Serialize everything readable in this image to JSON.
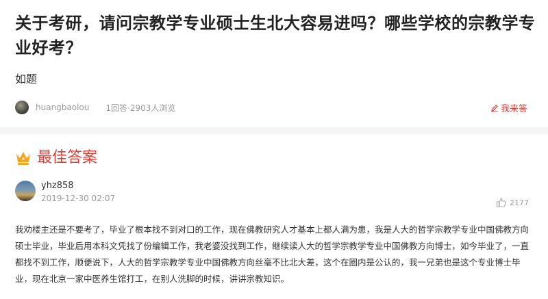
{
  "question": {
    "title": "关于考研，请问宗教学专业硕士生北大容易进吗？哪些学校的宗教学专业好考？",
    "description": "如题",
    "user": "huangbaolou",
    "stats": "1回答·2903人浏览",
    "answer_button": "我来答"
  },
  "best_answer": {
    "heading": "最佳答案",
    "author": "yhz858",
    "date": "2019-12-30 02:07",
    "likes": "2177",
    "text": "我劝楼主还是不要考了，毕业了根本找不到对口的工作，现在佛教研究人才基本上都人满为患，我是人大的哲学宗教学专业中国佛教方向硕士毕业，毕业后用本科文凭找了份编辑工作，我老婆没找到工作，继续读人大的哲学宗教学专业中国佛教方向博士，如今毕业了，一直都找不到工作，顺便说下，人大的哲学宗教学专业中国佛教方向丝毫不比北大差，这个在圈内是公认的，我一兄弟也是这个专业博士毕业，现在北京一家中医养生馆打工，在别人洗脚的时候，讲讲宗教知识。"
  },
  "colors": {
    "accent": "#e23e36",
    "muted": "#999999",
    "background": "#f4f5f5"
  },
  "icons": {
    "answer": "pencil-icon",
    "best": "crown-icon",
    "like": "thumbs-up-icon"
  }
}
